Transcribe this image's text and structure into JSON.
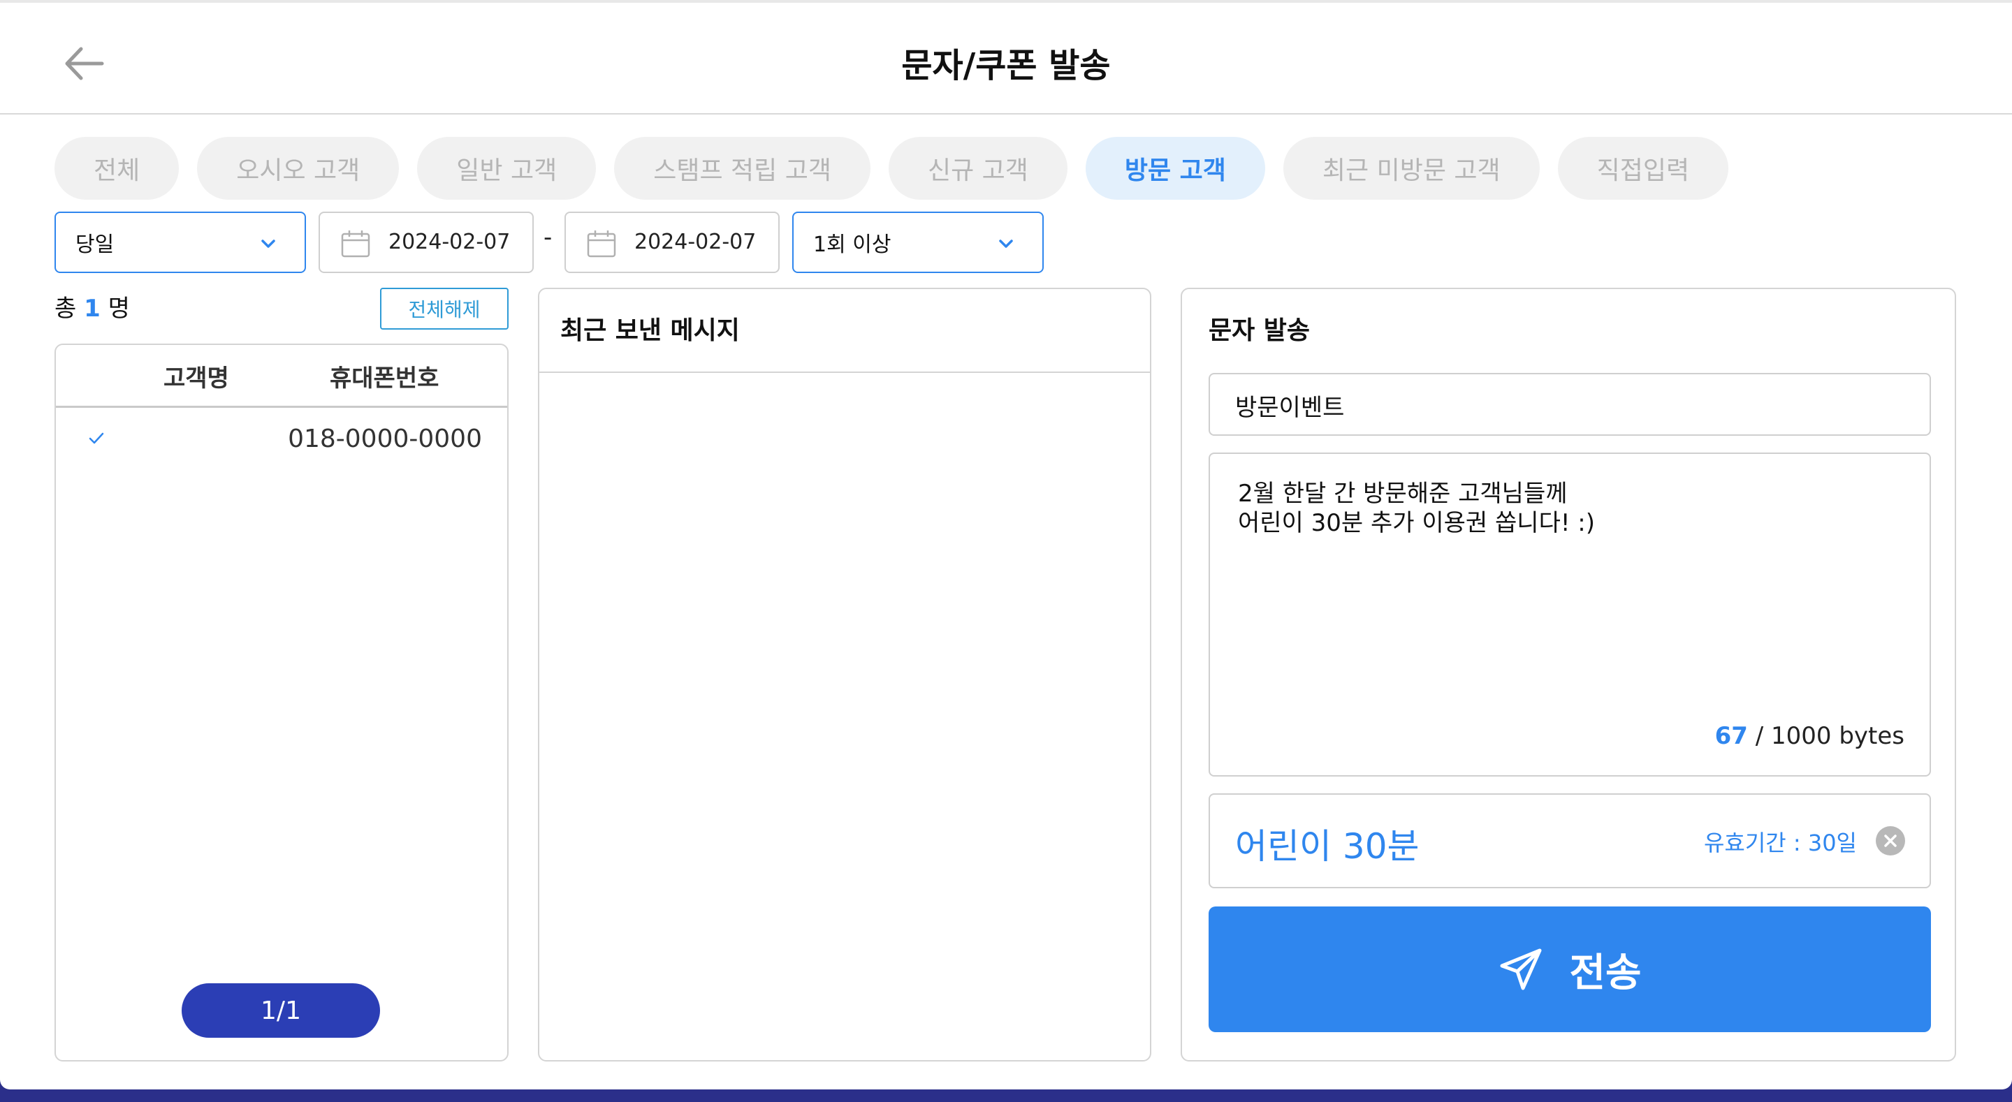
{
  "header": {
    "title": "문자/쿠폰 발송"
  },
  "tabs": [
    {
      "label": "전체",
      "active": false
    },
    {
      "label": "오시오 고객",
      "active": false
    },
    {
      "label": "일반 고객",
      "active": false
    },
    {
      "label": "스탬프 적립 고객",
      "active": false
    },
    {
      "label": "신규 고객",
      "active": false
    },
    {
      "label": "방문 고객",
      "active": true
    },
    {
      "label": "최근 미방문 고객",
      "active": false
    },
    {
      "label": "직접입력",
      "active": false
    }
  ],
  "filters": {
    "period": "당일",
    "start_date": "2024-02-07",
    "separator": "-",
    "end_date": "2024-02-07",
    "visit_count": "1회 이상"
  },
  "customers": {
    "total_prefix": "총",
    "total_count": "1",
    "total_suffix": "명",
    "clear_all_label": "전체해제",
    "columns": {
      "name": "고객명",
      "phone": "휴대폰번호"
    },
    "rows": [
      {
        "name": "",
        "phone": "018-0000-0000",
        "checked": true
      }
    ],
    "pager": "1/1"
  },
  "recent": {
    "title": "최근 보낸 메시지"
  },
  "sms": {
    "title": "문자 발송",
    "subject": "방문이벤트",
    "body": "2월 한달 간 방문해준 고객님들께\n어린이 30분 추가 이용권 쏩니다! :)",
    "bytes_used": "67",
    "bytes_limit": "/ 1000 bytes",
    "coupon": {
      "name": "어린이 30분",
      "validity": "유효기간 : 30일"
    },
    "send_label": "전송"
  },
  "colors": {
    "accent": "#2f86ee",
    "pager": "#2b3eb5",
    "tab_inactive_text": "#b5b5b5"
  }
}
